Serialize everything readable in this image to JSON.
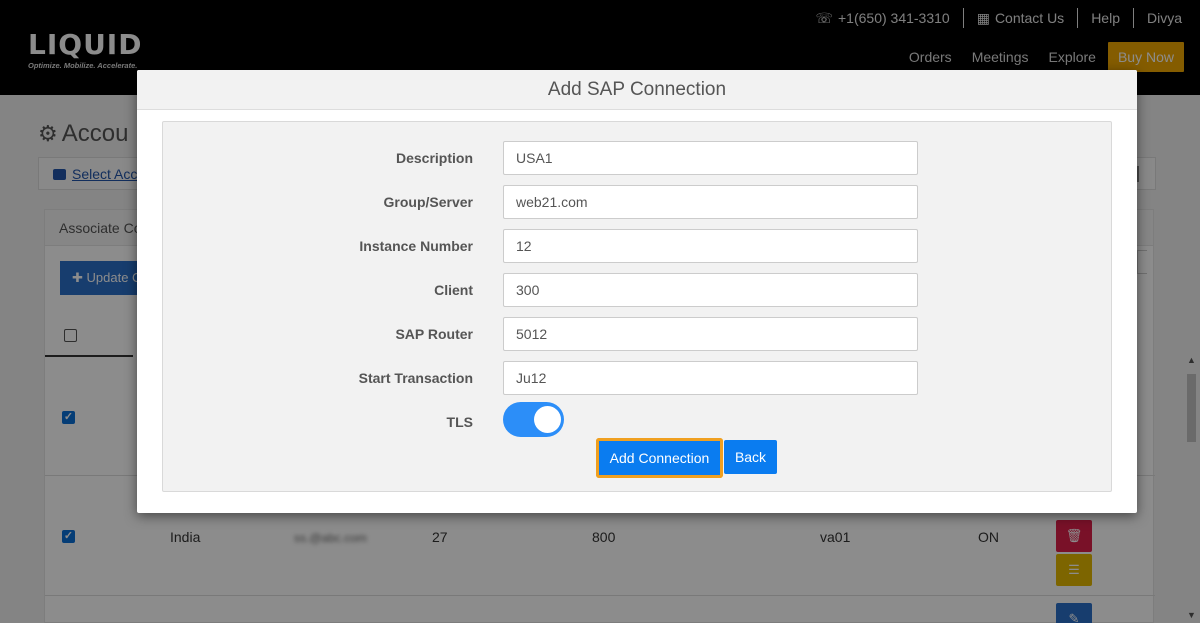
{
  "header": {
    "logo_text": "LIQUID",
    "logo_tagline": "Optimize. Mobilize. Accelerate.",
    "phone": "+1(650) 341-3310",
    "contact": "Contact Us",
    "help": "Help",
    "user": "Divya",
    "nav": {
      "orders": "Orders",
      "meetings": "Meetings",
      "explore": "Explore",
      "buy_now": "Buy Now"
    }
  },
  "page": {
    "title": "Accou",
    "select_account_link": "Select Acc",
    "panel_heading": "Associate Co",
    "update_button": "Update C"
  },
  "table": {
    "visible_row": {
      "description": "India",
      "email": "ss.@abc.com",
      "instance": "27",
      "client": "800",
      "transaction": "va01",
      "tls": "ON"
    }
  },
  "modal": {
    "title": "Add SAP Connection",
    "fields": [
      {
        "label": "Description",
        "value": "USA1"
      },
      {
        "label": "Group/Server",
        "value": "web21.com"
      },
      {
        "label": "Instance Number",
        "value": "12"
      },
      {
        "label": "Client",
        "value": "300"
      },
      {
        "label": "SAP Router",
        "value": "5012"
      },
      {
        "label": "Start Transaction",
        "value": "Ju12"
      }
    ],
    "tls_label": "TLS",
    "tls_on": true,
    "add_button": "Add Connection",
    "back_button": "Back"
  },
  "colors": {
    "primary": "#0a7cf0",
    "focus_ring": "#f0a020",
    "buy_now": "#f0a800",
    "delete": "#dc1f4a"
  }
}
